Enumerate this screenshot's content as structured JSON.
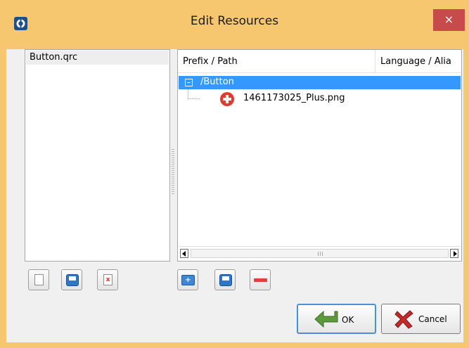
{
  "window": {
    "title": "Edit Resources",
    "close_symbol": "×",
    "title_bar_color": "#f6c76e",
    "close_button_color": "#c74b4b"
  },
  "files": {
    "items": [
      {
        "label": "Button.qrc"
      }
    ],
    "buttons": [
      {
        "icon": "new-file-icon"
      },
      {
        "icon": "save-icon"
      },
      {
        "icon": "remove-file-icon"
      }
    ]
  },
  "resources": {
    "columns": [
      "Prefix / Path",
      "Language / Alia"
    ],
    "prefix": {
      "label": "/Button",
      "selected": true,
      "selection_color": "#3399ff"
    },
    "children": [
      {
        "label": "1461173025_Plus.png",
        "icon": "red-plus-icon"
      }
    ],
    "buttons": [
      {
        "icon": "add-prefix-icon"
      },
      {
        "icon": "save-icon"
      },
      {
        "icon": "remove-icon"
      }
    ]
  },
  "dialog_buttons": {
    "ok_label": "OK",
    "cancel_label": "Cancel"
  }
}
